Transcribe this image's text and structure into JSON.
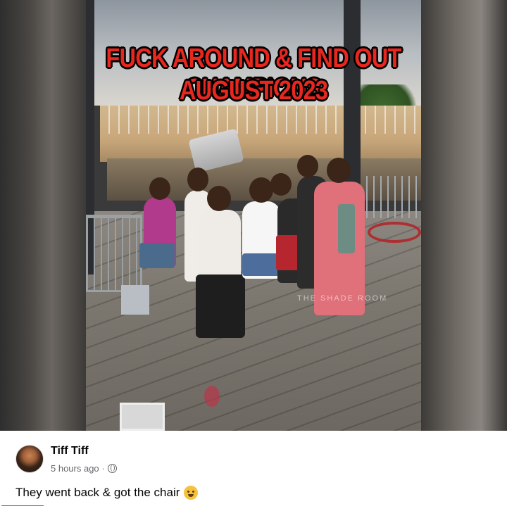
{
  "image_caption": {
    "line1": "FUCK AROUND & FIND OUT CHAMPIONS",
    "line2": "AUGUST 2023",
    "color": "#e8271f"
  },
  "photo": {
    "watermark": "THE SHADE ROOM"
  },
  "post": {
    "author": "Tiff Tiff",
    "timestamp": "5 hours ago",
    "separator": "·",
    "privacy_icon": "globe-icon",
    "text": "They went back & got the chair",
    "emoji": "grimacing-face-emoji"
  }
}
